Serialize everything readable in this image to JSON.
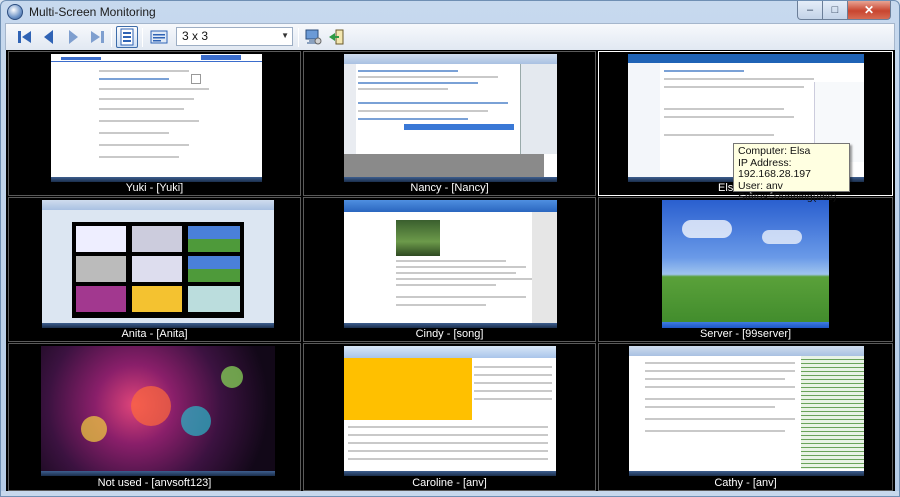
{
  "window": {
    "title": "Multi-Screen Monitoring",
    "buttons": {
      "minimize": "–",
      "maximize": "□",
      "close": "✕"
    }
  },
  "toolbar": {
    "layout_value": "3 x 3",
    "icons": [
      "first-icon",
      "previous-icon",
      "next-icon",
      "last-icon",
      "grid-view-icon",
      "list-view-icon",
      "computer-settings-icon",
      "exit-icon"
    ]
  },
  "cells": [
    {
      "caption": "Yuki - [Yuki]"
    },
    {
      "caption": "Nancy - [Nancy]"
    },
    {
      "caption": "Elsa - [anv]"
    },
    {
      "caption": "Anita - [Anita]"
    },
    {
      "caption": "Cindy - [song]"
    },
    {
      "caption": "Server - [99server]"
    },
    {
      "caption": "Not used - [anvsoft123]"
    },
    {
      "caption": "Caroline - [anv]"
    },
    {
      "caption": "Cathy - [anv]"
    }
  ],
  "tooltip": {
    "computer": "Computer: Elsa",
    "ip": "IP Address: 192.168.28.197",
    "user": "User: anv",
    "status": "Status: Running(Idle)"
  },
  "colors": {
    "accent": "#3d6ca9",
    "grid_background": "#000000",
    "tooltip_background": "#ffffe1"
  }
}
